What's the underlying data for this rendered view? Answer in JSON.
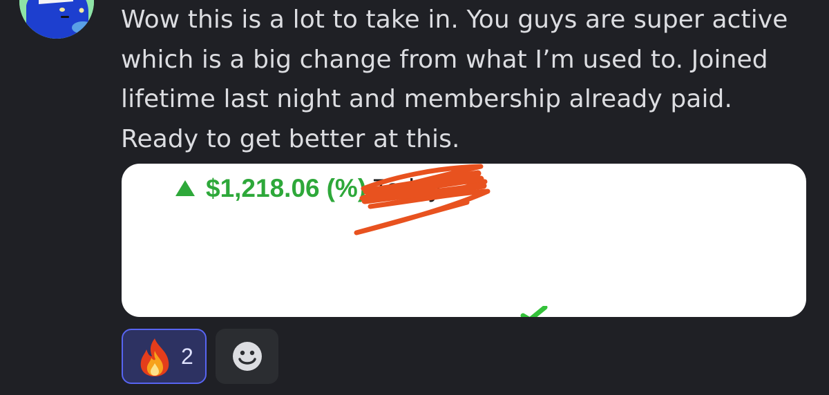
{
  "message": {
    "lines": [
      "Wow this is a lot to take in. You guys are super active",
      "which is a big change from what I’m used to. Joined",
      "lifetime last night and membership already paid.",
      "Ready to get better at this."
    ]
  },
  "attachment": {
    "gain_amount": "$1,218.06",
    "gain_percent_visible": "(%)",
    "period": "Today",
    "gain_color": "#2ea83a",
    "scribble_color": "#e8521f",
    "icons": [
      "up-triangle-icon",
      "check-mark-icon"
    ]
  },
  "reactions": [
    {
      "icon": "fire-emoji-icon",
      "count": "2",
      "selected": true
    },
    {
      "icon": "add-reaction-smiley-icon"
    }
  ],
  "colors": {
    "background": "#1f2025",
    "text": "#dcdde1",
    "reaction_selected_bg": "#2d3262",
    "reaction_selected_border": "#5865f2",
    "reaction_bg": "#2b2d31"
  }
}
